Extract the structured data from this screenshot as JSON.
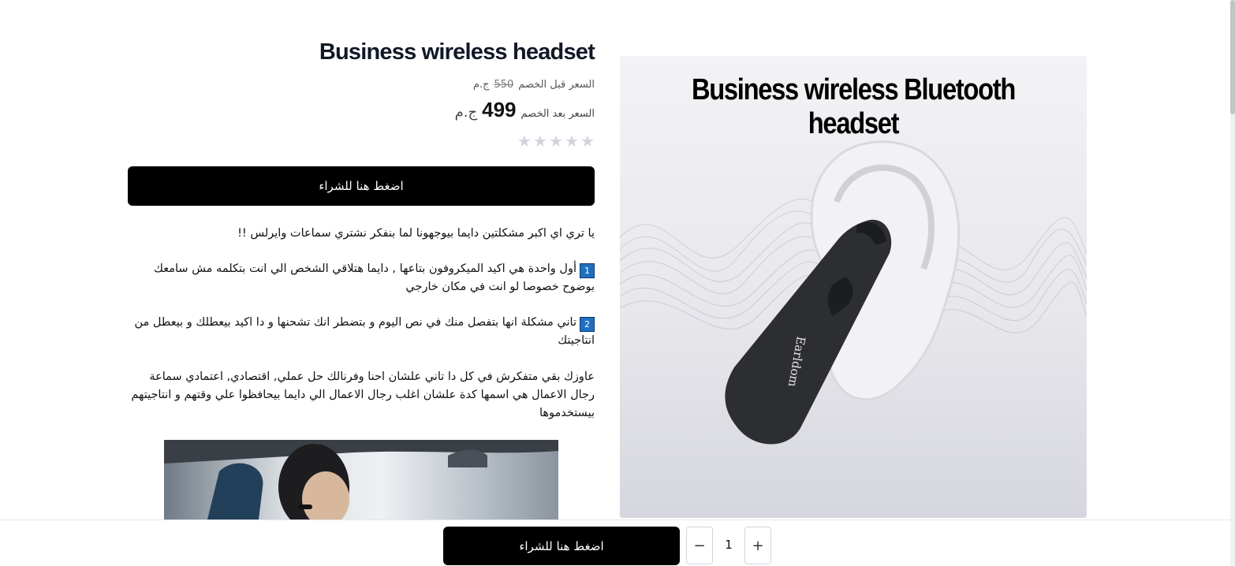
{
  "product": {
    "title": "Business wireless headset",
    "price_before_label": "السعر قبل الخصم",
    "price_before_value": "550",
    "price_after_label": "السعر بعد الخصم",
    "price_after_value": "499",
    "currency": "ج.م",
    "rating_stars": 0,
    "rating_max": 5
  },
  "buy_button_label": "اضغط هنا للشراء",
  "description": {
    "intro": "يا تري اي اكبر مشكلتين دايما بيوجهونا لما بنفكر نشتري سماعات وايرلس !!",
    "point1_number": "1",
    "point1": "أول واحدة هي اكيد الميكروفون بتاعها , دايما هتلاقي الشخص الي انت بتكلمه مش سامعك بوضوح خصوصا لو انت في مكان خارجي",
    "point2_number": "2",
    "point2": "تاني مشكلة انها بتفصل منك في نص اليوم و بتضطر انك تشحنها و دا اكيد بيعطلك و بيعطل من انتاجيتك",
    "closing": "عاوزك بقي متفكرش في كل دا تاني علشان احنا وفرنالك حل عملي, اقتصادي, اعتمادي سماعة رجال الاعمال هي اسمها كدة علشان اغلب رجال الاعمال الي دايما بيحافظوا علي وقتهم و انتاجيتهم بيستخدموها"
  },
  "product_image": {
    "caption": "Business wireless Bluetooth headset",
    "brand": "Earldom"
  },
  "sticky_bar": {
    "buy_label": "اضغط هنا للشراء",
    "quantity": "1",
    "minus_symbol": "−",
    "plus_symbol": "+"
  },
  "colors": {
    "button_bg": "#000000",
    "button_text": "#ffffff",
    "star_empty": "#d1d5db"
  }
}
